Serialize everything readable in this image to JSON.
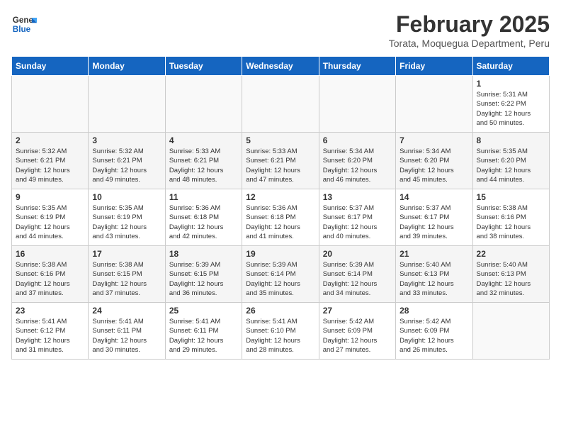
{
  "logo": {
    "line1": "General",
    "line2": "Blue"
  },
  "title": "February 2025",
  "subtitle": "Torata, Moquegua Department, Peru",
  "weekdays": [
    "Sunday",
    "Monday",
    "Tuesday",
    "Wednesday",
    "Thursday",
    "Friday",
    "Saturday"
  ],
  "weeks": [
    [
      {
        "day": "",
        "detail": ""
      },
      {
        "day": "",
        "detail": ""
      },
      {
        "day": "",
        "detail": ""
      },
      {
        "day": "",
        "detail": ""
      },
      {
        "day": "",
        "detail": ""
      },
      {
        "day": "",
        "detail": ""
      },
      {
        "day": "1",
        "detail": "Sunrise: 5:31 AM\nSunset: 6:22 PM\nDaylight: 12 hours\nand 50 minutes."
      }
    ],
    [
      {
        "day": "2",
        "detail": "Sunrise: 5:32 AM\nSunset: 6:21 PM\nDaylight: 12 hours\nand 49 minutes."
      },
      {
        "day": "3",
        "detail": "Sunrise: 5:32 AM\nSunset: 6:21 PM\nDaylight: 12 hours\nand 49 minutes."
      },
      {
        "day": "4",
        "detail": "Sunrise: 5:33 AM\nSunset: 6:21 PM\nDaylight: 12 hours\nand 48 minutes."
      },
      {
        "day": "5",
        "detail": "Sunrise: 5:33 AM\nSunset: 6:21 PM\nDaylight: 12 hours\nand 47 minutes."
      },
      {
        "day": "6",
        "detail": "Sunrise: 5:34 AM\nSunset: 6:20 PM\nDaylight: 12 hours\nand 46 minutes."
      },
      {
        "day": "7",
        "detail": "Sunrise: 5:34 AM\nSunset: 6:20 PM\nDaylight: 12 hours\nand 45 minutes."
      },
      {
        "day": "8",
        "detail": "Sunrise: 5:35 AM\nSunset: 6:20 PM\nDaylight: 12 hours\nand 44 minutes."
      }
    ],
    [
      {
        "day": "9",
        "detail": "Sunrise: 5:35 AM\nSunset: 6:19 PM\nDaylight: 12 hours\nand 44 minutes."
      },
      {
        "day": "10",
        "detail": "Sunrise: 5:35 AM\nSunset: 6:19 PM\nDaylight: 12 hours\nand 43 minutes."
      },
      {
        "day": "11",
        "detail": "Sunrise: 5:36 AM\nSunset: 6:18 PM\nDaylight: 12 hours\nand 42 minutes."
      },
      {
        "day": "12",
        "detail": "Sunrise: 5:36 AM\nSunset: 6:18 PM\nDaylight: 12 hours\nand 41 minutes."
      },
      {
        "day": "13",
        "detail": "Sunrise: 5:37 AM\nSunset: 6:17 PM\nDaylight: 12 hours\nand 40 minutes."
      },
      {
        "day": "14",
        "detail": "Sunrise: 5:37 AM\nSunset: 6:17 PM\nDaylight: 12 hours\nand 39 minutes."
      },
      {
        "day": "15",
        "detail": "Sunrise: 5:38 AM\nSunset: 6:16 PM\nDaylight: 12 hours\nand 38 minutes."
      }
    ],
    [
      {
        "day": "16",
        "detail": "Sunrise: 5:38 AM\nSunset: 6:16 PM\nDaylight: 12 hours\nand 37 minutes."
      },
      {
        "day": "17",
        "detail": "Sunrise: 5:38 AM\nSunset: 6:15 PM\nDaylight: 12 hours\nand 37 minutes."
      },
      {
        "day": "18",
        "detail": "Sunrise: 5:39 AM\nSunset: 6:15 PM\nDaylight: 12 hours\nand 36 minutes."
      },
      {
        "day": "19",
        "detail": "Sunrise: 5:39 AM\nSunset: 6:14 PM\nDaylight: 12 hours\nand 35 minutes."
      },
      {
        "day": "20",
        "detail": "Sunrise: 5:39 AM\nSunset: 6:14 PM\nDaylight: 12 hours\nand 34 minutes."
      },
      {
        "day": "21",
        "detail": "Sunrise: 5:40 AM\nSunset: 6:13 PM\nDaylight: 12 hours\nand 33 minutes."
      },
      {
        "day": "22",
        "detail": "Sunrise: 5:40 AM\nSunset: 6:13 PM\nDaylight: 12 hours\nand 32 minutes."
      }
    ],
    [
      {
        "day": "23",
        "detail": "Sunrise: 5:41 AM\nSunset: 6:12 PM\nDaylight: 12 hours\nand 31 minutes."
      },
      {
        "day": "24",
        "detail": "Sunrise: 5:41 AM\nSunset: 6:11 PM\nDaylight: 12 hours\nand 30 minutes."
      },
      {
        "day": "25",
        "detail": "Sunrise: 5:41 AM\nSunset: 6:11 PM\nDaylight: 12 hours\nand 29 minutes."
      },
      {
        "day": "26",
        "detail": "Sunrise: 5:41 AM\nSunset: 6:10 PM\nDaylight: 12 hours\nand 28 minutes."
      },
      {
        "day": "27",
        "detail": "Sunrise: 5:42 AM\nSunset: 6:09 PM\nDaylight: 12 hours\nand 27 minutes."
      },
      {
        "day": "28",
        "detail": "Sunrise: 5:42 AM\nSunset: 6:09 PM\nDaylight: 12 hours\nand 26 minutes."
      },
      {
        "day": "",
        "detail": ""
      }
    ]
  ]
}
